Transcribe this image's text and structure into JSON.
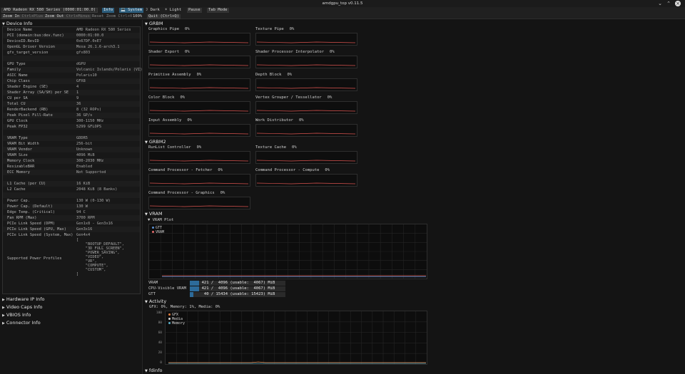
{
  "window": {
    "title": "amdgpu_top v0.11.5",
    "controls": [
      "⌄",
      "⌃",
      "×"
    ]
  },
  "toolbar": {
    "device_select": "AMD Radeon RX 580 Series (0000:01:00.0)",
    "info_tab": "Info",
    "system_tab": "💻 System",
    "dark": "☽ Dark",
    "light": "☀ Light",
    "pause": "Pause",
    "tab_mode": "Tab Mode",
    "zoom_in": "Zoom In",
    "zoom_in_key": "Ctrl+Plus",
    "zoom_out": "Zoom Out",
    "zoom_out_key": "Ctrl+Minus",
    "reset_zoom": "Reset Zoom",
    "reset_zoom_key": "Ctrl+0",
    "zoom_level": "100%",
    "quit": "Quit (Ctrl+Q)"
  },
  "left": {
    "device_info_header": "Device Info",
    "rows": [
      {
        "k": "Device Name",
        "v": "AMD Radeon RX 580 Series"
      },
      {
        "k": "PCI (domain:bus:dev.func)",
        "v": "0000:01:00.0"
      },
      {
        "k": "DeviceID.RevID",
        "v": "0x67DF.0xE7"
      },
      {
        "k": "OpenGL Driver Version",
        "v": "Mesa 26.1.6-arch3.1"
      },
      {
        "k": "gfx_target_version",
        "v": "gfx803"
      },
      {
        "k": "",
        "v": ""
      },
      {
        "k": "GPU Type",
        "v": "dGPU"
      },
      {
        "k": "Family",
        "v": "Volcanic Islands/Polaris (VI)"
      },
      {
        "k": "ASIC Name",
        "v": "Polaris10"
      },
      {
        "k": "Chip Class",
        "v": "GFX8"
      },
      {
        "k": "Shader Engine (SE)",
        "v": "4"
      },
      {
        "k": "Shader Array (SA/SH) per SE",
        "v": "1"
      },
      {
        "k": "CU per SA",
        "v": "9"
      },
      {
        "k": "Total CU",
        "v": "36"
      },
      {
        "k": "RenderBackend (RB)",
        "v": "8 (32 ROPs)"
      },
      {
        "k": "Peak Pixel Fill-Rate",
        "v": "36 GP/s"
      },
      {
        "k": "GPU Clock",
        "v": "300-1150 MHz"
      },
      {
        "k": "Peak FP32",
        "v": "5299 GFLOPS"
      },
      {
        "k": "",
        "v": ""
      },
      {
        "k": "VRAM Type",
        "v": "GDDR5"
      },
      {
        "k": "VRAM Bit Width",
        "v": "256-bit"
      },
      {
        "k": "VRAM Vendor",
        "v": "Unknown"
      },
      {
        "k": "VRAM Size",
        "v": "4096 MiB"
      },
      {
        "k": "Memory Clock",
        "v": "300-2030 MHz"
      },
      {
        "k": "ResizableBAR",
        "v": "Enabled"
      },
      {
        "k": "ECC Memory",
        "v": "Not Supported"
      },
      {
        "k": "",
        "v": ""
      },
      {
        "k": "L1 Cache (per CU)",
        "v": "  16 KiB"
      },
      {
        "k": "L2 Cache",
        "v": "2048 KiB (8 Banks)"
      },
      {
        "k": "",
        "v": ""
      },
      {
        "k": "Power Cap.",
        "v": " 130 W (0-130 W)"
      },
      {
        "k": "Power Cap. (Default)",
        "v": " 130 W"
      },
      {
        "k": "Edge Temp. (Critical)",
        "v": "  94 C"
      },
      {
        "k": "Fan RPM (Max)",
        "v": "3700 RPM"
      },
      {
        "k": "PCIe Link Speed (DPM)",
        "v": "Gen1x8 - Gen3x16"
      },
      {
        "k": "PCIe Link Speed (GPU, Max)",
        "v": "Gen3x16"
      },
      {
        "k": "PCIe Link Speed (System, Max)",
        "v": "Gen4x4"
      }
    ],
    "profiles_label": "Supported Power Profiles",
    "profiles_value": "[\n    \"BOOTUP_DEFAULT\",\n    \"3D_FULL_SCREEN\",\n    \"POWER_SAVING\",\n    \"VIDEO\",\n    \"VR\",\n    \"COMPUTE\",\n    \"CUSTOM\",\n]",
    "collapsed": [
      "Hardware IP Info",
      "Video Caps Info",
      "VBIOS Info",
      "Connector Info"
    ]
  },
  "grbm": {
    "title": "GRBM",
    "items": [
      {
        "label": "Graphics Pipe",
        "pct": "0%"
      },
      {
        "label": "Texture Pipe",
        "pct": "0%"
      },
      {
        "label": "Shader Export",
        "pct": "0%"
      },
      {
        "label": "Shader Processor Interpolator",
        "pct": "0%"
      },
      {
        "label": "Primitive Assembly",
        "pct": "0%"
      },
      {
        "label": "Depth Block",
        "pct": "0%"
      },
      {
        "label": "Color Block",
        "pct": "0%"
      },
      {
        "label": "Vertex Grouper / Tessellator",
        "pct": "0%"
      },
      {
        "label": "Input Assembly",
        "pct": "0%"
      },
      {
        "label": "Work Distributor",
        "pct": "0%"
      }
    ]
  },
  "grbm2": {
    "title": "GRBM2",
    "items": [
      {
        "label": "RunList Controller",
        "pct": "0%"
      },
      {
        "label": "Texture Cache",
        "pct": "0%"
      },
      {
        "label": "Command Processor -  Fetcher",
        "pct": "0%"
      },
      {
        "label": "Command Processor -  Compute",
        "pct": "0%"
      },
      {
        "label": "Command Processor - Graphics",
        "pct": "0%"
      }
    ]
  },
  "vram": {
    "title": "VRAM",
    "plot_title": "VRAM Plot",
    "legend": [
      {
        "name": "GTT",
        "color": "#5b8fd0"
      },
      {
        "name": "VRAM",
        "color": "#e06a6a"
      }
    ],
    "bars": [
      {
        "label": "VRAM",
        "text": "  421 /  4096 (usable:  4067) MiB",
        "fraction": 0.1
      },
      {
        "label": "CPU-Visible VRAM",
        "text": "  421 /  4096 (usable:  4067) MiB",
        "fraction": 0.1
      },
      {
        "label": "GTT",
        "text": "   40 / 15434 (usable: 15423) MiB",
        "fraction": 0.003
      }
    ]
  },
  "activity": {
    "title": "Activity",
    "summary": "GFX:   0%, Memory:   1%, Media:   0%",
    "legend": [
      {
        "name": "GFX",
        "color": "#e07a3a"
      },
      {
        "name": "Media",
        "color": "#d8d8d8"
      },
      {
        "name": "Memory",
        "color": "#5bb0c8"
      }
    ],
    "yticks": [
      "100",
      "80",
      "60",
      "40",
      "20",
      "0"
    ]
  },
  "fdinfo": {
    "title": "fdinfo"
  }
}
